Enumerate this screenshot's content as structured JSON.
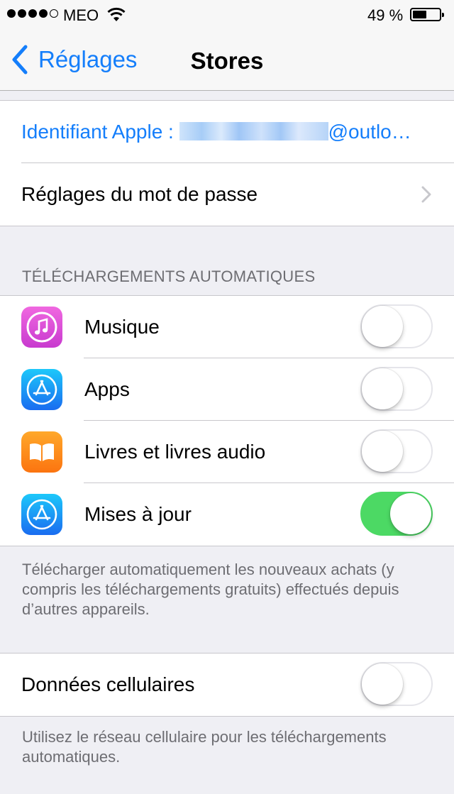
{
  "status_bar": {
    "carrier": "MEO",
    "battery": "49 %",
    "battery_level": 0.49
  },
  "nav": {
    "back_label": "Réglages",
    "title": "Stores"
  },
  "account": {
    "apple_id_prefix": "Identifiant Apple : ",
    "apple_id_suffix": "@outlo…",
    "password_settings": "Réglages du mot de passe"
  },
  "auto_downloads": {
    "header": "TÉLÉCHARGEMENTS AUTOMATIQUES",
    "items": [
      {
        "label": "Musique",
        "icon": "music-icon",
        "on": false
      },
      {
        "label": "Apps",
        "icon": "app-store-icon",
        "on": false
      },
      {
        "label": "Livres et livres audio",
        "icon": "books-icon",
        "on": false
      },
      {
        "label": "Mises à jour",
        "icon": "app-store-icon",
        "on": true
      }
    ],
    "footer": "Télécharger automatiquement les nouveaux achats (y compris les téléchargements gratuits) effectués depuis d’autres appareils."
  },
  "cellular": {
    "label": "Données cellulaires",
    "on": false,
    "footer": "Utilisez le réseau cellulaire pour les téléchargements automatiques."
  },
  "colors": {
    "accent": "#147efb",
    "toggle_on": "#4cd964",
    "background": "#efeff4"
  }
}
